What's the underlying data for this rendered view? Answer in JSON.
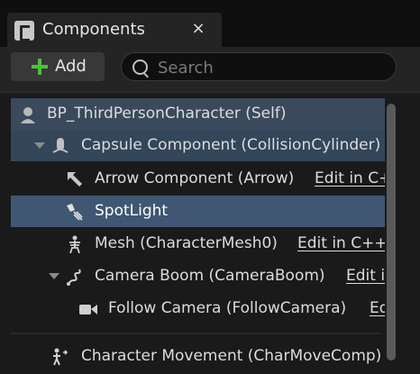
{
  "tab": {
    "title": "Components",
    "close_label": "×",
    "icon": "blueprint-class-icon"
  },
  "toolbar": {
    "add_label": "Add",
    "search_placeholder": "Search",
    "search_value": ""
  },
  "tree": {
    "rows": [
      {
        "label": "BP_ThirdPersonCharacter (Self)",
        "icon": "character-icon",
        "link": "",
        "expanded": null,
        "selected": false
      },
      {
        "label": "Capsule Component (CollisionCylinder)",
        "icon": "capsule-component-icon",
        "link": "",
        "expanded": true,
        "selected": false
      },
      {
        "label": "Arrow Component (Arrow)",
        "icon": "arrow-component-icon",
        "link": "Edit in C++",
        "expanded": null,
        "selected": false
      },
      {
        "label": "SpotLight",
        "icon": "spotlight-icon",
        "link": "",
        "expanded": null,
        "selected": true
      },
      {
        "label": "Mesh (CharacterMesh0)",
        "icon": "skeletal-mesh-icon",
        "link": "Edit in C++",
        "expanded": null,
        "selected": false
      },
      {
        "label": "Camera Boom (CameraBoom)",
        "icon": "spring-arm-icon",
        "link": "Edit in C++",
        "expanded": true,
        "selected": false
      },
      {
        "label": "Follow Camera (FollowCamera)",
        "icon": "camera-icon",
        "link": "Edit in C++",
        "expanded": null,
        "selected": false
      },
      {
        "label": "Character Movement (CharMoveComp)",
        "icon": "character-movement-icon",
        "link": "",
        "expanded": null,
        "selected": false
      }
    ]
  }
}
